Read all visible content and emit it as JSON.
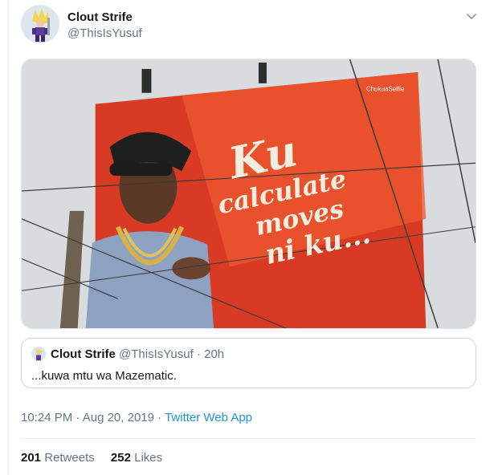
{
  "tweet": {
    "author": {
      "display_name": "Clout Strife",
      "handle": "@ThisIsYusuf"
    },
    "billboard": {
      "social_handle": "ChukuaSelfie",
      "headline_lines": [
        "Ku",
        "calculate",
        "moves",
        "ni ku..."
      ]
    },
    "quote": {
      "author_name": "Clout Strife",
      "author_handle": "@ThisIsYusuf",
      "separator": "·",
      "age": "20h",
      "text": "...kuwa mtu wa Mazematic."
    },
    "timestamp": {
      "time": "10:24 PM",
      "separator": "·",
      "date": "Aug 20, 2019",
      "app": "Twitter Web App"
    },
    "stats": {
      "retweets_count": "201",
      "retweets_label": "Retweets",
      "likes_count": "252",
      "likes_label": "Likes"
    }
  },
  "icons": {
    "caret": "chevron-down-icon"
  },
  "colors": {
    "link": "#1b95e0",
    "secondary_text": "#657786",
    "primary_text": "#14171a",
    "billboard_red": "#d93a24",
    "billboard_orange": "#ee5a2f"
  }
}
